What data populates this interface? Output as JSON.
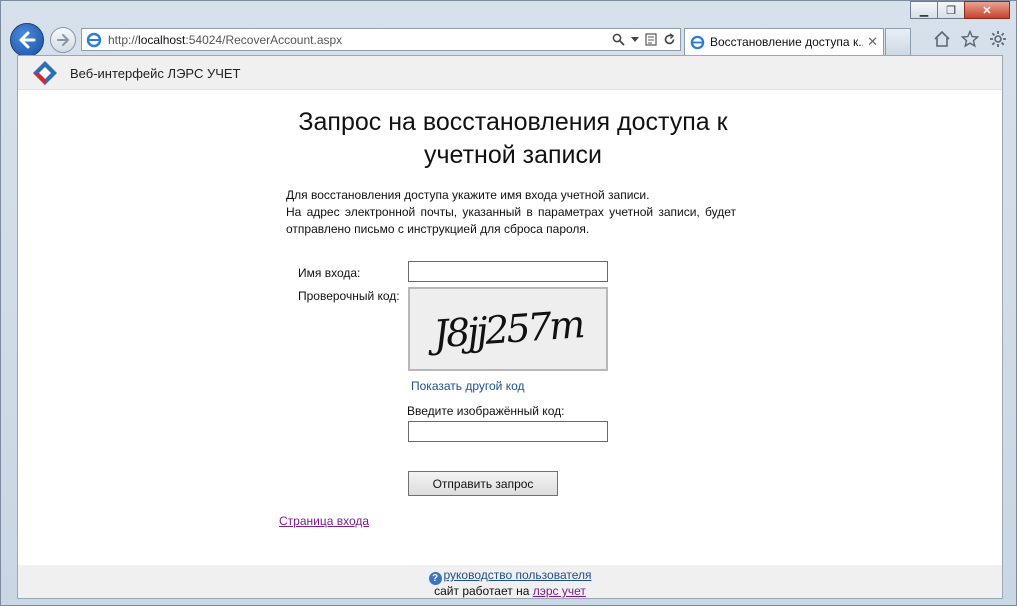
{
  "browser": {
    "address_prefix": "http://",
    "address_host": "localhost",
    "address_rest": ":54024/RecoverAccount.aspx",
    "tab_title": "Восстановление доступа к...",
    "tab_close": "✕"
  },
  "app": {
    "title": "Веб-интерфейс ЛЭРС УЧЕТ"
  },
  "page": {
    "title": "Запрос на восстановления доступа к учетной записи",
    "intro_line1": "Для восстановления доступа укажите имя входа учетной записи.",
    "intro_line2": "На адрес электронной почты, указанный в параметрах учетной записи, будет отправлено письмо с инструкцией для сброса пароля."
  },
  "form": {
    "login_label": "Имя входа:",
    "login_value": "",
    "captcha_label": "Проверочный код:",
    "captcha_text": "J8jj257m",
    "refresh_captcha_link": "Показать другой код",
    "code_label": "Введите изображённый код:",
    "code_value": "",
    "submit_label": "Отправить запрос",
    "login_page_link": "Страница входа"
  },
  "footer": {
    "help_icon_glyph": "?",
    "manual_link": "руководство пользователя",
    "powered_by": "сайт работает на",
    "powered_by_link": "лэрс учет"
  },
  "icons": {
    "back": "back-arrow-icon",
    "forward": "forward-arrow-icon",
    "ie": "ie-logo-icon",
    "search": "search-icon",
    "dropdown": "dropdown-icon",
    "compat": "compatibility-view-icon",
    "refresh": "refresh-icon",
    "home": "home-icon",
    "favorites": "star-icon",
    "tools": "gear-icon",
    "logo": "lers-logo-icon"
  },
  "colors": {
    "link_blue": "#1f4e8c",
    "link_visited": "#7a1f8c"
  }
}
